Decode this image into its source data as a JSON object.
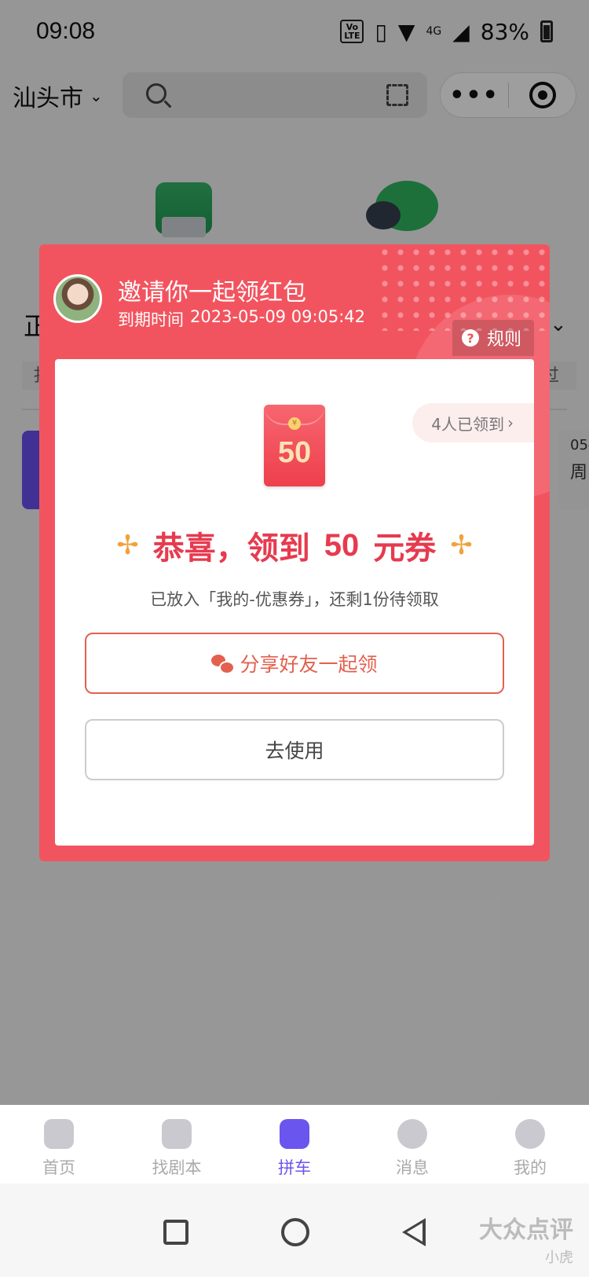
{
  "status_bar": {
    "time": "09:08",
    "volte": "VoLTE",
    "network": "4G",
    "battery": "83%"
  },
  "top_bar": {
    "city": "汕头市",
    "menu_dots": "•••"
  },
  "background_content": {
    "section_title_fragment": "正",
    "chip_left_fragment": "扌",
    "chip_right_fragment": "过",
    "card_right_date_fragment": "05-",
    "card_right_weekday_fragment": "周"
  },
  "modal": {
    "title": "邀请你一起领红包",
    "expiry_label": "到期时间",
    "expiry_value": "2023-05-09 09:05:42",
    "rules_label": "规则",
    "claimed_count": "4人已领到",
    "envelope_amount": "50",
    "congrats_prefix": "恭喜，领到",
    "congrats_amount": "50",
    "congrats_suffix": "元券",
    "subtext": "已放入「我的-优惠券」，还剩1份待领取",
    "share_button": "分享好友一起领",
    "use_button": "去使用"
  },
  "tab_bar": {
    "tabs": [
      {
        "label": "首页",
        "icon": "home-icon",
        "active": false
      },
      {
        "label": "找剧本",
        "icon": "script-icon",
        "active": false
      },
      {
        "label": "拼车",
        "icon": "puzzle-icon",
        "active": true
      },
      {
        "label": "消息",
        "icon": "message-icon",
        "active": false
      },
      {
        "label": "我的",
        "icon": "profile-icon",
        "active": false
      }
    ]
  },
  "watermark": {
    "brand": "大众点评",
    "user": "小虎"
  },
  "colors": {
    "accent": "#6a55ee",
    "modal_red": "#f2545f",
    "congrats_red": "#e63b4f",
    "share_orange": "#e3604f"
  }
}
